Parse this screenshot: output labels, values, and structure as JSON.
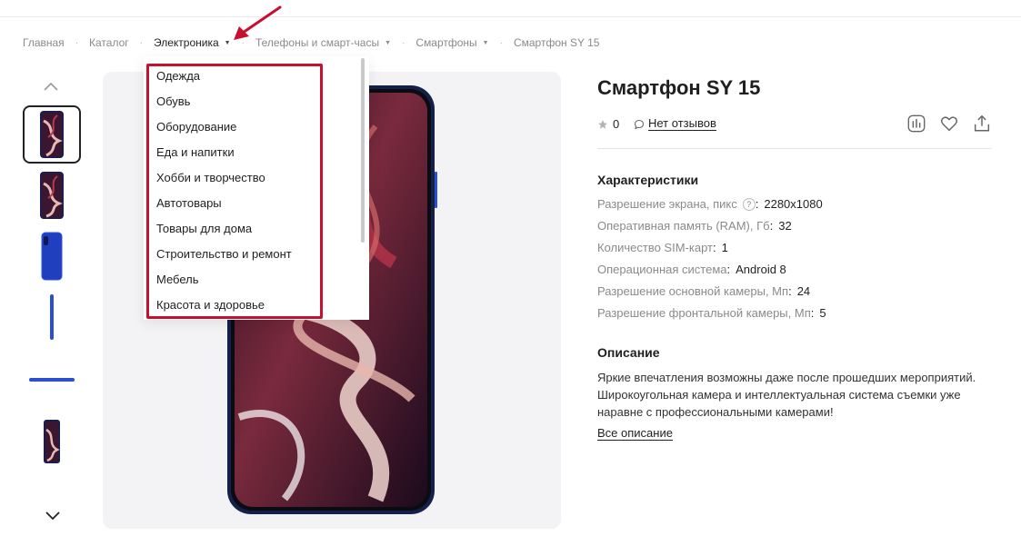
{
  "breadcrumb": {
    "items": [
      {
        "label": "Главная"
      },
      {
        "label": "Каталог"
      },
      {
        "label": "Электроника",
        "has_dropdown": true,
        "active": true
      },
      {
        "label": "Телефоны и смарт-часы",
        "has_dropdown": true
      },
      {
        "label": "Смартфоны",
        "has_dropdown": true
      },
      {
        "label": "Смартфон SY 15"
      }
    ],
    "separator": "·"
  },
  "dropdown": {
    "items": [
      "Одежда",
      "Обувь",
      "Оборудование",
      "Еда и напитки",
      "Хобби и творчество",
      "Автотовары",
      "Товары для дома",
      "Строительство и ремонт",
      "Мебель",
      "Красота и здоровье"
    ],
    "highlight_color": "#c8102e"
  },
  "gallery": {
    "thumbnail_count": 6,
    "selected_index": 0
  },
  "product": {
    "title": "Смартфон SY 15",
    "rating": "0",
    "reviews_label": "Нет отзывов"
  },
  "specs": {
    "title": "Характеристики",
    "rows": [
      {
        "label": "Разрешение экрана, пикс",
        "help": "?",
        "value": "2280x1080"
      },
      {
        "label": "Оперативная память (RAM), Гб",
        "value": "32"
      },
      {
        "label": "Количество SIM-карт",
        "value": "1"
      },
      {
        "label": "Операционная система",
        "value": "Android 8"
      },
      {
        "label": "Разрешение основной камеры, Мп",
        "value": "24"
      },
      {
        "label": "Разрешение фронтальной камеры, Мп",
        "value": "5"
      }
    ]
  },
  "description": {
    "title": "Описание",
    "text": "Яркие впечатления возможны даже после прошедших мероприятий. Широкоугольная камера и интеллектуальная система съемки уже наравне с профессиональными камерами!",
    "more_link": "Все описание"
  },
  "icons": {
    "compare": "compare-icon",
    "favorite": "heart-icon",
    "share": "share-icon",
    "star": "star-icon",
    "reviews": "chat-icon"
  }
}
